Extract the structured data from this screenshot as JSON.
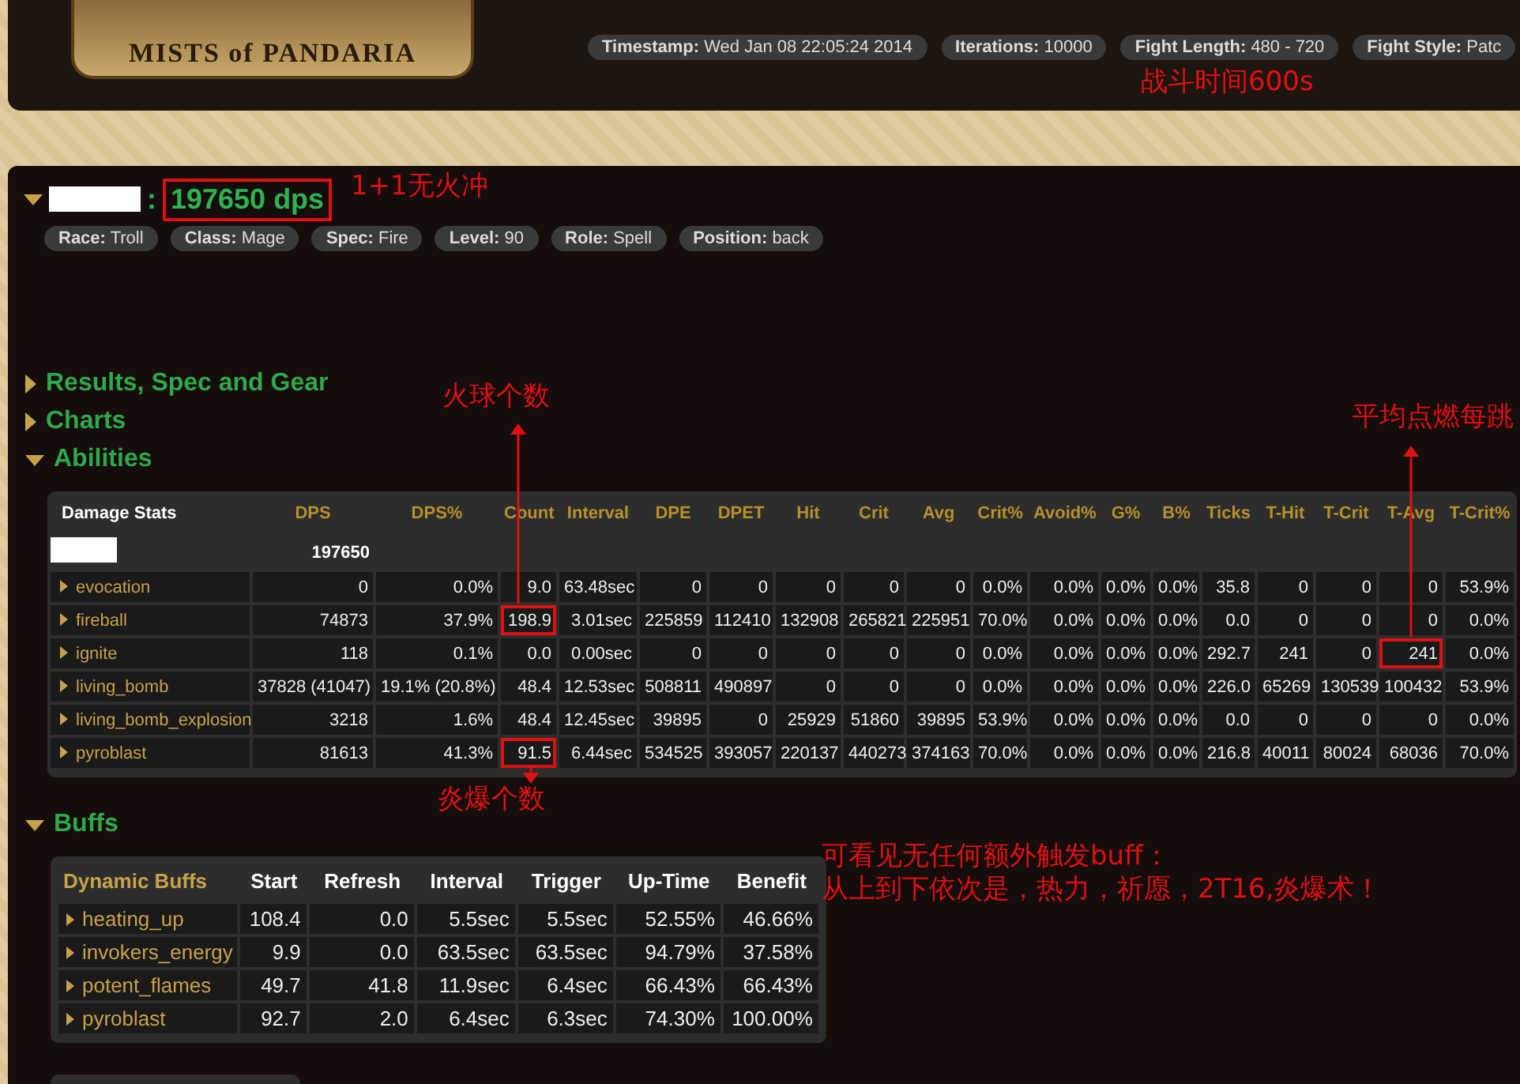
{
  "header": {
    "logo_subtitle": "MISTS of PANDARIA",
    "badges": [
      {
        "label": "Timestamp:",
        "value": "Wed Jan 08 22:05:24 2014"
      },
      {
        "label": "Iterations:",
        "value": "10000"
      },
      {
        "label": "Fight Length:",
        "value": "480 - 720"
      },
      {
        "label": "Fight Style:",
        "value": "Patc"
      }
    ]
  },
  "player": {
    "expanded": true,
    "separator": ":",
    "dps": "197650 dps",
    "dps_marked": true,
    "badges": [
      {
        "label": "Race:",
        "value": "Troll"
      },
      {
        "label": "Class:",
        "value": "Mage"
      },
      {
        "label": "Spec:",
        "value": "Fire"
      },
      {
        "label": "Level:",
        "value": "90"
      },
      {
        "label": "Role:",
        "value": "Spell"
      },
      {
        "label": "Position:",
        "value": "back"
      }
    ]
  },
  "sections": [
    {
      "title": "Results, Spec and Gear",
      "expanded": false
    },
    {
      "title": "Charts",
      "expanded": false
    },
    {
      "title": "Abilities",
      "expanded": true
    }
  ],
  "abilities_table": {
    "columns": [
      "Damage Stats",
      "DPS",
      "DPS%",
      "Count",
      "Interval",
      "DPE",
      "DPET",
      "Hit",
      "Crit",
      "Avg",
      "Crit%",
      "Avoid%",
      "G%",
      "B%",
      "Ticks",
      "T-Hit",
      "T-Crit",
      "T-Avg",
      "T-Crit%"
    ],
    "total_dps": "197650",
    "rows": [
      {
        "cells": [
          "evocation",
          "0",
          "0.0%",
          "9.0",
          "63.48sec",
          "0",
          "0",
          "0",
          "0",
          "0",
          "0.0%",
          "0.0%",
          "0.0%",
          "0.0%",
          "35.8",
          "0",
          "0",
          "0",
          "53.9%"
        ]
      },
      {
        "cells": [
          "fireball",
          "74873",
          "37.9%",
          {
            "text": "198.9",
            "marked": true
          },
          "3.01sec",
          "225859",
          "112410",
          "132908",
          "265821",
          "225951",
          "70.0%",
          "0.0%",
          "0.0%",
          "0.0%",
          "0.0",
          "0",
          "0",
          "0",
          "0.0%"
        ]
      },
      {
        "cells": [
          "ignite",
          "118",
          "0.1%",
          "0.0",
          "0.00sec",
          "0",
          "0",
          "0",
          "0",
          "0",
          "0.0%",
          "0.0%",
          "0.0%",
          "0.0%",
          "292.7",
          "241",
          "0",
          {
            "text": "241",
            "marked": true
          },
          "0.0%"
        ]
      },
      {
        "cells": [
          "living_bomb",
          "37828 (41047)",
          "19.1% (20.8%)",
          "48.4",
          "12.53sec",
          "508811",
          "490897",
          "0",
          "0",
          "0",
          "0.0%",
          "0.0%",
          "0.0%",
          "0.0%",
          "226.0",
          "65269",
          "130539",
          "100432",
          "53.9%"
        ]
      },
      {
        "cells": [
          "living_bomb_explosion",
          "3218",
          "1.6%",
          "48.4",
          "12.45sec",
          "39895",
          "0",
          "25929",
          "51860",
          "39895",
          "53.9%",
          "0.0%",
          "0.0%",
          "0.0%",
          "0.0",
          "0",
          "0",
          "0",
          "0.0%"
        ]
      },
      {
        "cells": [
          "pyroblast",
          "81613",
          "41.3%",
          {
            "text": "91.5",
            "marked": true
          },
          "6.44sec",
          "534525",
          "393057",
          "220137",
          "440273",
          "374163",
          "70.0%",
          "0.0%",
          "0.0%",
          "0.0%",
          "216.8",
          "40011",
          "80024",
          "68036",
          "70.0%"
        ]
      }
    ]
  },
  "buffs_section": {
    "title": "Buffs",
    "expanded": true
  },
  "buffs_table": {
    "columns": [
      "Dynamic Buffs",
      "Start",
      "Refresh",
      "Interval",
      "Trigger",
      "Up-Time",
      "Benefit"
    ],
    "rows": [
      {
        "cells": [
          "heating_up",
          "108.4",
          "0.0",
          "5.5sec",
          "5.5sec",
          "52.55%",
          "46.66%"
        ]
      },
      {
        "cells": [
          "invokers_energy",
          "9.9",
          "0.0",
          "63.5sec",
          "63.5sec",
          "94.79%",
          "37.58%"
        ]
      },
      {
        "cells": [
          "potent_flames",
          "49.7",
          "41.8",
          "11.9sec",
          "6.4sec",
          "66.43%",
          "66.43%"
        ]
      },
      {
        "cells": [
          "pyroblast",
          "92.7",
          "2.0",
          "6.4sec",
          "6.3sec",
          "74.30%",
          "100.00%"
        ]
      }
    ]
  },
  "annotations": [
    {
      "kind": "fight_time",
      "lines": [
        "战斗时间600s"
      ]
    },
    {
      "kind": "dps_note",
      "lines": [
        "1+1无火冲"
      ]
    },
    {
      "kind": "fireball_count",
      "lines": [
        "火球个数"
      ]
    },
    {
      "kind": "ignite_tick",
      "lines": [
        "平均点燃每跳"
      ]
    },
    {
      "kind": "pyro_count",
      "lines": [
        "炎爆个数"
      ]
    },
    {
      "kind": "buff_note",
      "lines": [
        "可看见无任何额外触发buff：",
        "从上到下依次是，热力，祈愿，2T16,炎爆术！"
      ]
    }
  ]
}
